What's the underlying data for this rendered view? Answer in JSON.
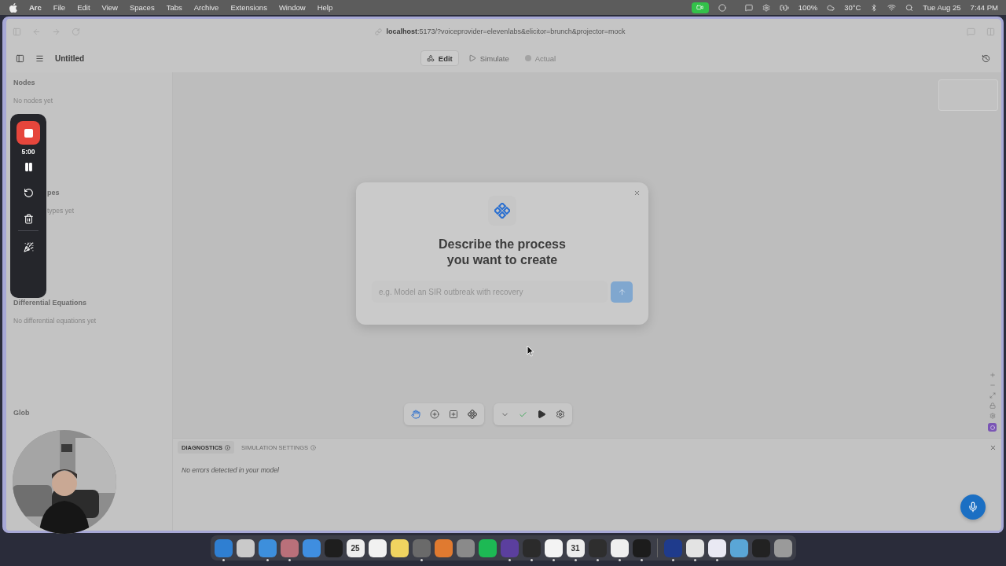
{
  "menu_bar": {
    "app": "Arc",
    "menus": [
      "File",
      "Edit",
      "View",
      "Spaces",
      "Tabs",
      "Archive",
      "Extensions",
      "Window",
      "Help"
    ],
    "battery": "100%",
    "weather": "30°C",
    "date": "Tue Aug 25",
    "time": "7:44 PM"
  },
  "browser": {
    "url": "**localhost**:5173/?voiceprovider=elevenlabs&elicitor=brunch&projector=mock"
  },
  "app": {
    "title": "Untitled",
    "modes": [
      {
        "label": "Edit",
        "kind": "edit",
        "selected": true,
        "disabled": false
      },
      {
        "label": "Simulate",
        "kind": "simulate",
        "selected": false,
        "disabled": false
      },
      {
        "label": "Actual",
        "kind": "actual",
        "selected": false,
        "disabled": true
      }
    ]
  },
  "sidebar": {
    "sections": [
      {
        "heading": "Nodes",
        "empty": "No nodes yet",
        "covered": false
      },
      {
        "heading": "pes",
        "empty": "types yet",
        "covered": true
      },
      {
        "heading": "Differential Equations",
        "empty": "No differential equations yet",
        "covered": false
      },
      {
        "heading": "Glob",
        "covered": false
      }
    ]
  },
  "recorder": {
    "timer": "5:00"
  },
  "modal": {
    "title": "Describe the process you want to create",
    "placeholder": "e.g. Model an SIR outbreak with recovery"
  },
  "canvas_toolbar": {
    "tools": [
      {
        "kind": "hand",
        "selected": true
      },
      {
        "kind": "add-circle",
        "selected": false
      },
      {
        "kind": "add-square",
        "selected": false
      },
      {
        "kind": "nodes",
        "selected": false
      }
    ],
    "model_valid": true
  },
  "panel": {
    "tabs": [
      {
        "label": "DIAGNOSTICS",
        "selected": true
      },
      {
        "label": "SIMULATION SETTINGS",
        "selected": false
      }
    ],
    "message": "No errors detected in your model"
  },
  "dock": {
    "apps": [
      {
        "kind": "app",
        "color": "#2f7fd2",
        "running": true
      },
      {
        "kind": "app",
        "color": "#c9c9c9",
        "running": false
      },
      {
        "kind": "app",
        "color": "#3d8fdc",
        "running": true
      },
      {
        "kind": "app",
        "color": "#b9707a",
        "running": true
      },
      {
        "kind": "app",
        "color": "#3f8ee0",
        "running": false
      },
      {
        "kind": "app",
        "color": "#1e1e1e",
        "running": false
      },
      {
        "kind": "app",
        "color": "#eeeeee",
        "running": false,
        "text": "25"
      },
      {
        "kind": "app",
        "color": "#f1f1f1",
        "running": false
      },
      {
        "kind": "app",
        "color": "#f0d460",
        "running": false
      },
      {
        "kind": "app",
        "color": "#6a6a6a",
        "running": true
      },
      {
        "kind": "app",
        "color": "#e07a30",
        "running": false
      },
      {
        "kind": "app",
        "color": "#8a8a8a",
        "running": false
      },
      {
        "kind": "app",
        "color": "#1db954",
        "running": false
      },
      {
        "kind": "app",
        "color": "#5b3f9e",
        "running": true
      },
      {
        "kind": "app",
        "color": "#2b2b2b",
        "running": true
      },
      {
        "kind": "app",
        "color": "#f3f3f3",
        "running": true
      },
      {
        "kind": "app",
        "color": "#ececec",
        "running": true,
        "text": "31"
      },
      {
        "kind": "app",
        "color": "#2e2e2e",
        "running": true
      },
      {
        "kind": "app",
        "color": "#efefef",
        "running": true
      },
      {
        "kind": "app",
        "color": "#1c1c1c",
        "running": true
      },
      {
        "kind": "separator"
      },
      {
        "kind": "app",
        "color": "#1f3b8c",
        "running": true
      },
      {
        "kind": "app",
        "color": "#e3e3e3",
        "running": true
      },
      {
        "kind": "app",
        "color": "#e9e9f3",
        "running": true
      },
      {
        "kind": "app",
        "color": "#5aa6d6",
        "running": false
      },
      {
        "kind": "app",
        "color": "#222222",
        "running": false
      },
      {
        "kind": "app",
        "color": "#9a9a9a",
        "running": false
      }
    ]
  }
}
